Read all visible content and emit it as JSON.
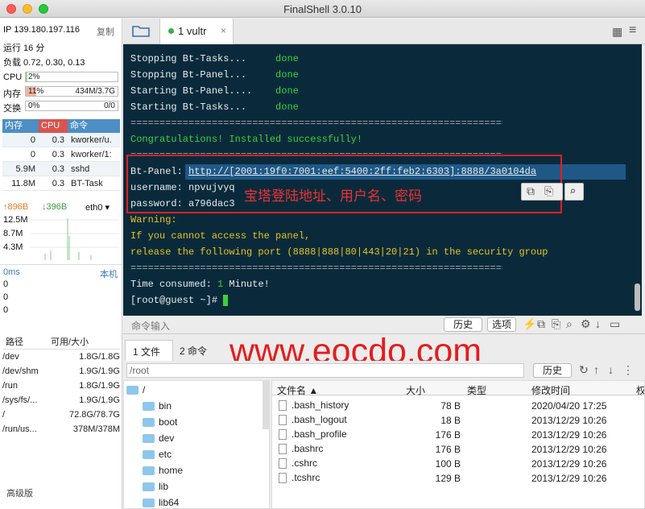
{
  "window": {
    "title": "FinalShell 3.0.10"
  },
  "sidebar": {
    "ip_label": "IP 139.180.197.116",
    "copy": "复制",
    "uptime": "运行 16 分",
    "load": "负载 0.72, 0.30, 0.13",
    "cpu": {
      "label": "CPU",
      "text": "2%",
      "fill": 0.02
    },
    "mem": {
      "label": "内存",
      "text": "11%",
      "value": "434M/3.7G",
      "fill": 0.11
    },
    "swap": {
      "label": "交换",
      "text": "0%",
      "value": "0/0",
      "fill": 0
    },
    "proc_headers": [
      "内存",
      "CPU",
      "命令"
    ],
    "processes": [
      {
        "mem": "0",
        "cpu": "0.3",
        "cmd": "kworker/u."
      },
      {
        "mem": "0",
        "cpu": "0.3",
        "cmd": "kworker/1:"
      },
      {
        "mem": "5.9M",
        "cpu": "0.3",
        "cmd": "sshd"
      },
      {
        "mem": "11.8M",
        "cpu": "0.3",
        "cmd": "BT-Task"
      }
    ],
    "net": {
      "up": "↑896B",
      "down": "↓396B",
      "iface": "eth0",
      "y_labels": [
        "12.5M",
        "8.7M",
        "4.3M"
      ]
    },
    "latency": {
      "ms": "0ms",
      "host": "本机",
      "vals": [
        "0",
        "0",
        "0"
      ]
    },
    "disk_headers": [
      "路径",
      "可用/大小"
    ],
    "disks": [
      {
        "path": "/dev",
        "size": "1.8G/1.8G"
      },
      {
        "path": "/dev/shm",
        "size": "1.9G/1.9G"
      },
      {
        "path": "/run",
        "size": "1.8G/1.9G"
      },
      {
        "path": "/sys/fs/...",
        "size": "1.9G/1.9G"
      },
      {
        "path": "/",
        "size": "72.8G/78.7G"
      },
      {
        "path": "/run/us...",
        "size": "378M/378M"
      }
    ],
    "advanced": "高级版"
  },
  "tabs": {
    "session": "1 vultr"
  },
  "terminal": {
    "l1": "Stopping Bt-Tasks...",
    "l2": "Stopping Bt-Panel...",
    "l3": "Starting Bt-Panel....",
    "l4": "Starting Bt-Tasks...",
    "done": "done",
    "sep": "==================================================================",
    "congrats": "Congratulations! Installed successfully!",
    "panel_label": "Bt-Panel: ",
    "panel_url": "http://[2001:19f0:7001:eef:5400:2ff:feb2:6303]:8888/3a0104da",
    "username": "username: npvujvyq",
    "password": "password: a796dac3",
    "warning": "Warning:",
    "warn1": "If you cannot access the panel,",
    "warn2": "release the following port (8888|888|80|443|20|21) in the security group",
    "time_label": "Time consumed: ",
    "time_num": "1",
    "time_unit": " Minute!",
    "prompt": "[root@guest ~]# ",
    "annotation": "宝塔登陆地址、用户名、密码",
    "cmd_placeholder": "命令输入",
    "history": "历史",
    "options": "选项"
  },
  "watermark": "www.eocdo.com",
  "bottom": {
    "tab_files": "1 文件",
    "tab_cmds": "2 命令",
    "path": "/root",
    "history": "历史",
    "tree_root": "/",
    "tree": [
      "bin",
      "boot",
      "dev",
      "etc",
      "home",
      "lib",
      "lib64"
    ],
    "file_headers": [
      "文件名 ▲",
      "大小",
      "类型",
      "修改时间",
      "权"
    ],
    "files": [
      {
        "name": ".bash_history",
        "size": "78 B",
        "time": "2020/04/20 17:25"
      },
      {
        "name": ".bash_logout",
        "size": "18 B",
        "time": "2013/12/29 10:26"
      },
      {
        "name": ".bash_profile",
        "size": "176 B",
        "time": "2013/12/29 10:26"
      },
      {
        "name": ".bashrc",
        "size": "176 B",
        "time": "2013/12/29 10:26"
      },
      {
        "name": ".cshrc",
        "size": "100 B",
        "time": "2013/12/29 10:26"
      },
      {
        "name": ".tcshrc",
        "size": "129 B",
        "time": "2013/12/29 10:26"
      }
    ]
  }
}
